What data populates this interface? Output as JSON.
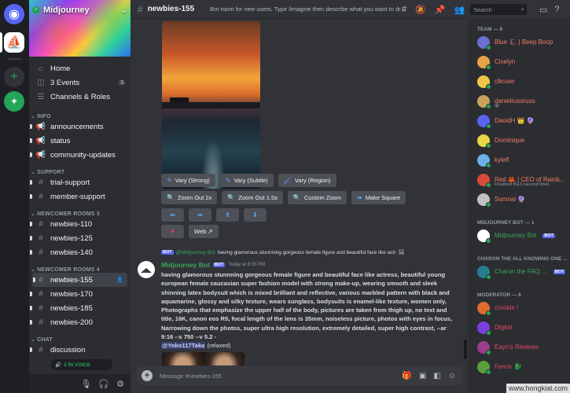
{
  "server": {
    "name": "Midjourney"
  },
  "sidebar": {
    "top": [
      {
        "label": "Home",
        "icon": "home-icon"
      },
      {
        "label": "3 Events",
        "badge": "3",
        "icon": "calendar-icon"
      },
      {
        "label": "Channels & Roles",
        "icon": "list-icon"
      }
    ],
    "categories": [
      {
        "name": "INFO",
        "channels": [
          "announcements",
          "status",
          "community-updates"
        ]
      },
      {
        "name": "SUPPORT",
        "channels": [
          "trial-support",
          "member-support"
        ]
      },
      {
        "name": "NEWCOMER ROOMS 3",
        "channels": [
          "newbies-110",
          "newbies-125",
          "newbies-140"
        ]
      },
      {
        "name": "NEWCOMER ROOMS 4",
        "channels": [
          "newbies-155",
          "newbies-170",
          "newbies-185",
          "newbies-200"
        ]
      },
      {
        "name": "CHAT",
        "channels": [
          "discussion"
        ]
      }
    ],
    "selected": "newbies-155",
    "voice_label": "2 IN VOICE"
  },
  "header": {
    "channel": "newbies-155",
    "topic": "Bot room for new users. Type /imagine then describe what you want to draw...",
    "search_placeholder": "Search"
  },
  "message1": {
    "buttons_row1": [
      {
        "icon": "✎",
        "label": "Vary (Strong)"
      },
      {
        "icon": "✎",
        "label": "Vary (Subtle)"
      },
      {
        "icon": "🖌",
        "label": "Vary (Region)"
      }
    ],
    "buttons_row2": [
      {
        "icon": "🔍",
        "label": "Zoom Out 2x"
      },
      {
        "icon": "🔍",
        "label": "Zoom Out 1.5x"
      },
      {
        "icon": "🔍",
        "label": "Custom Zoom"
      },
      {
        "icon": "⬌",
        "label": "Make Square"
      }
    ],
    "arrows": [
      "⬅",
      "➡",
      "⬆",
      "⬇"
    ],
    "web_label": "Web ↗",
    "heart": "♥"
  },
  "message2": {
    "reply_author": "@Midjourney Bot",
    "reply_text": "having glamorous stunnning gorgeous female figure and beautiful face like actr",
    "author": "Midjourney Bot",
    "bot_tag": "BOT",
    "timestamp": "Today at 6:33 PM",
    "text": "having glamorous stunnning gorgeous female figure and beautiful face like actress, beautiful young european female caucasian super fashion model with strong make-up, wearing smooth and sleek shinning latex bodysuit which is mixed brilliant and reflective, various marbled pattern with black and aquamarine, glossy and silky texture, wears sunglass, bodysuits is enamel-like texture, women only, Photographs that emphasize the upper half of the body, pictures are taken from thigh up, no text and title, 16K, canon eos R5, focal length of the lens is 35mm, noiseless picture, photos with eyes in focus, Narrowing down the photos, super ultra high resolution, extremely detailed, super high contrast, --ar 9:16 --s 750 --v 5.2 -",
    "mention": "@Yoko117Taka",
    "mode": "(relaxed)"
  },
  "composer": {
    "placeholder": "Message #newbies-155"
  },
  "members": {
    "groups": [
      {
        "title": "TEAM — 9",
        "list": [
          {
            "name": "Blue 🎩 | Beep Boop",
            "color": "#f47b67",
            "av": "#6b6fd1"
          },
          {
            "name": "Cixelyn",
            "color": "#f47b67",
            "av": "#e6a24a"
          },
          {
            "name": "clkruse",
            "color": "#f47b67",
            "av": "#f0c64a"
          },
          {
            "name": "danielrussruss",
            "color": "#f47b67",
            "av": "#c9a25e",
            "sub": "😭"
          },
          {
            "name": "DavidH 👑 🔮",
            "color": "#f47b67",
            "av": "#5865f2"
          },
          {
            "name": "Dominique",
            "color": "#f47b67",
            "av": "#e8d547"
          },
          {
            "name": "kylelf",
            "color": "#f47b67",
            "av": "#6bb0e8"
          },
          {
            "name": "Red 🦀 | CEO of Rainb...",
            "color": "#f47b67",
            "av": "#d94a3a",
            "sub": "Finalized BG3 (second time)"
          },
          {
            "name": "Somnai 🔮",
            "color": "#f47b67",
            "av": "#c0c0c0"
          }
        ]
      },
      {
        "title": "MIDJOURNEY BOT — 1",
        "list": [
          {
            "name": "Midjourney Bot",
            "color": "#3ba55d",
            "av": "#ffffff",
            "bot": "BOT"
          }
        ]
      },
      {
        "title": "CHARON THE ALL KNOWING ONE ...",
        "list": [
          {
            "name": "Charon the FAQ ...",
            "color": "#3ba55d",
            "av": "#2a7d8c",
            "bot": "BOT"
          }
        ]
      },
      {
        "title": "MODERATOR — 8",
        "list": [
          {
            "name": "crookie !",
            "color": "#e8466b",
            "av": "#e06a2c"
          },
          {
            "name": "Digital",
            "color": "#e8466b",
            "av": "#7b3fe0"
          },
          {
            "name": "Eayn's Reviews",
            "color": "#e8466b",
            "av": "#a03c8c"
          },
          {
            "name": "Fenrix 🐉",
            "color": "#e8466b",
            "av": "#5a9e3c"
          }
        ]
      }
    ]
  },
  "watermark": "www.hongkiat.com"
}
